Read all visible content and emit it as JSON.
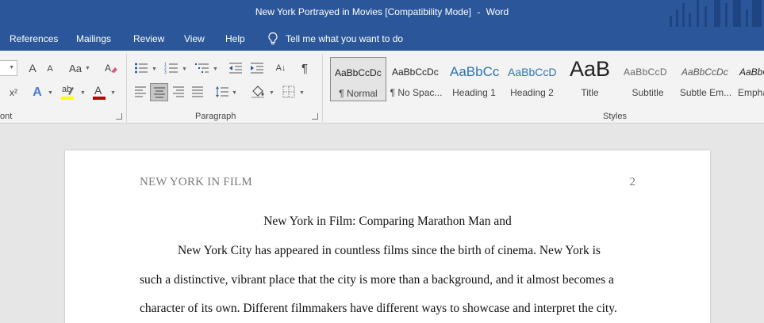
{
  "window": {
    "doc_title": "New York Portrayed in Movies [Compatibility Mode]",
    "separator": "-",
    "app_name": "Word"
  },
  "tabs": [
    "References",
    "Mailings",
    "Review",
    "View",
    "Help"
  ],
  "tell_me": "Tell me what you want to do",
  "ribbon": {
    "font_group_label": "ont",
    "paragraph_group_label": "Paragraph",
    "styles_group_label": "Styles",
    "font_grow": "A",
    "font_shrink": "A",
    "change_case": "Aa",
    "superscript": "x²",
    "text_effects": "A",
    "font_color": "A",
    "highlight": "ab",
    "sort": "A↓",
    "show_marks": "¶"
  },
  "styles": [
    {
      "sample": "AaBbCcDc",
      "name": "¶ Normal"
    },
    {
      "sample": "AaBbCcDc",
      "name": "¶ No Spac..."
    },
    {
      "sample": "AaBbCc",
      "name": "Heading 1"
    },
    {
      "sample": "AaBbCcD",
      "name": "Heading 2"
    },
    {
      "sample": "AaB",
      "name": "Title"
    },
    {
      "sample": "AaBbCcD",
      "name": "Subtitle"
    },
    {
      "sample": "AaBbCcDc",
      "name": "Subtle Em..."
    },
    {
      "sample": "AaBbCcDc",
      "name": "Empha"
    }
  ],
  "document": {
    "running_head": "NEW YORK IN FILM",
    "page_number": "2",
    "title": "New York in Film: Comparing Marathon Man and",
    "lines": [
      "New York City has appeared in countless films since the birth of cinema. New York is",
      "such a distinctive, vibrant place that the city is more than a background, and it almost becomes a",
      "character of its own. Different filmmakers have different ways to showcase and interpret the city."
    ]
  },
  "colors": {
    "accent": "#2b579a",
    "ribbon_bg": "#f3f3f3",
    "heading_blue": "#2e74b5",
    "font_color_red": "#c00000",
    "highlight_yellow": "#ffff00"
  }
}
